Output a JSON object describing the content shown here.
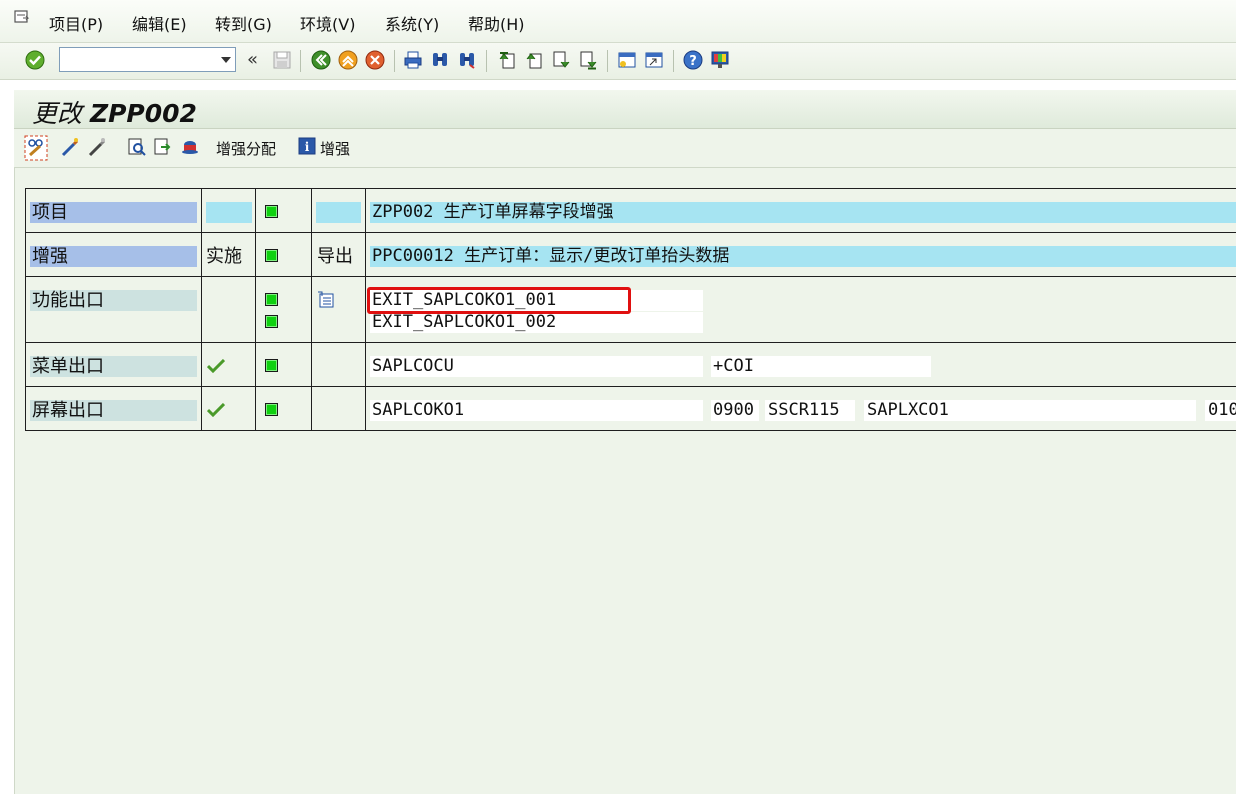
{
  "menu": {
    "items": [
      "项目(P)",
      "编辑(E)",
      "转到(G)",
      "环境(V)",
      "系统(Y)",
      "帮助(H)"
    ]
  },
  "toolbar": {
    "command_value": "",
    "back_glyph": "«"
  },
  "screen": {
    "title_prefix": "更改",
    "title_object": "ZPP002"
  },
  "app_toolbar": {
    "assign_label": "增强分配",
    "enhance_label": "增强"
  },
  "rows": [
    {
      "label": "项目",
      "col2": "",
      "col4": "",
      "value": "ZPP002   生产订单屏幕字段增强"
    },
    {
      "label": "增强",
      "col2": "实施",
      "col4": "导出",
      "value": "PPC00012 生产订单：显示/更改订单抬头数据"
    },
    {
      "label": "功能出口",
      "exit1": "EXIT_SAPLCOKO1_001",
      "exit2": "EXIT_SAPLCOKO1_002"
    },
    {
      "label": "菜单出口",
      "program": "SAPLCOCU",
      "code": "+COI"
    },
    {
      "label": "屏幕出口",
      "program": "SAPLCOKO1",
      "screen": "0900",
      "area": "SSCR115",
      "sub_program": "SAPLXCO1",
      "sub_screen": "010"
    }
  ],
  "colors": {
    "label_blue": "#a6bfe8",
    "value_cyan": "#a6e4f2",
    "label_gray": "#cde2e0",
    "bg_green": "#eef4ea",
    "led_green": "#10d010",
    "highlight_red": "#e01010"
  },
  "icons": [
    "menu-frame-icon",
    "enter-check-icon",
    "save-icon",
    "back-icon",
    "exit-icon",
    "cancel-icon",
    "print-icon",
    "find-icon",
    "find-next-icon",
    "first-page-icon",
    "prev-page-icon",
    "next-page-icon",
    "last-page-icon",
    "new-session-icon",
    "shortcut-icon",
    "help-icon",
    "customize-layout-icon",
    "display-change-icon",
    "activate-icon",
    "deactivate-icon",
    "where-used-icon",
    "compare-icon",
    "cat-icon",
    "info-icon",
    "traffic-light-icon",
    "checkmark-icon",
    "function-module-icon"
  ]
}
